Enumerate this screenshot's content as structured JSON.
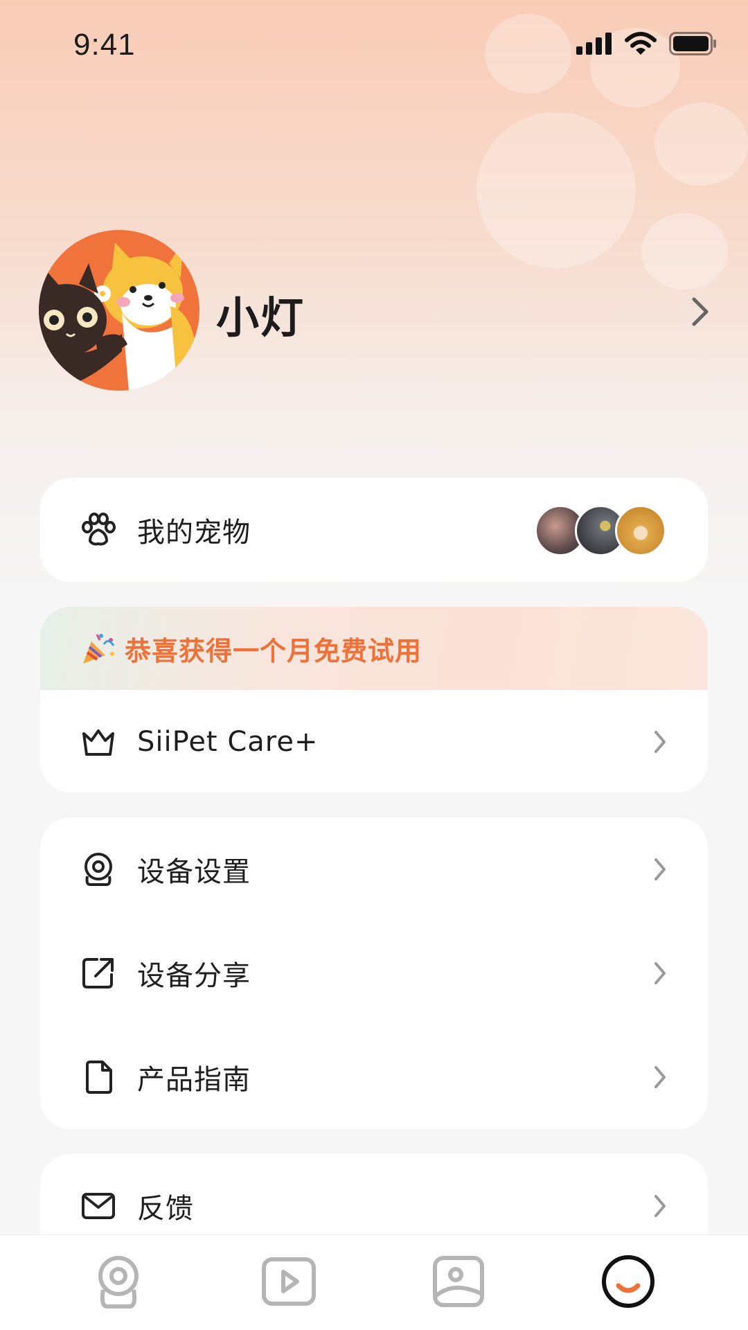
{
  "status_bar": {
    "time": "9:41"
  },
  "profile": {
    "username": "小灯"
  },
  "pets": {
    "label": "我的宠物",
    "avatar_colors": [
      "#7a6a6a",
      "#5a5f66",
      "#d9a441"
    ]
  },
  "promo": {
    "text": "恭喜获得一个月免费试用"
  },
  "care_plus": {
    "label": "SiiPet Care+"
  },
  "menu": [
    {
      "label": "设备设置",
      "icon": "camera-icon"
    },
    {
      "label": "设备分享",
      "icon": "share-icon"
    },
    {
      "label": "产品指南",
      "icon": "document-icon"
    }
  ],
  "feedback": {
    "label": "反馈",
    "icon": "mail-icon"
  },
  "tabbar": {
    "tabs": [
      "camera-tab",
      "video-tab",
      "gallery-tab",
      "profile-tab"
    ],
    "active": "profile-tab"
  },
  "colors": {
    "accent": "#f07138",
    "background": "#f6f6f6",
    "card": "#ffffff"
  }
}
